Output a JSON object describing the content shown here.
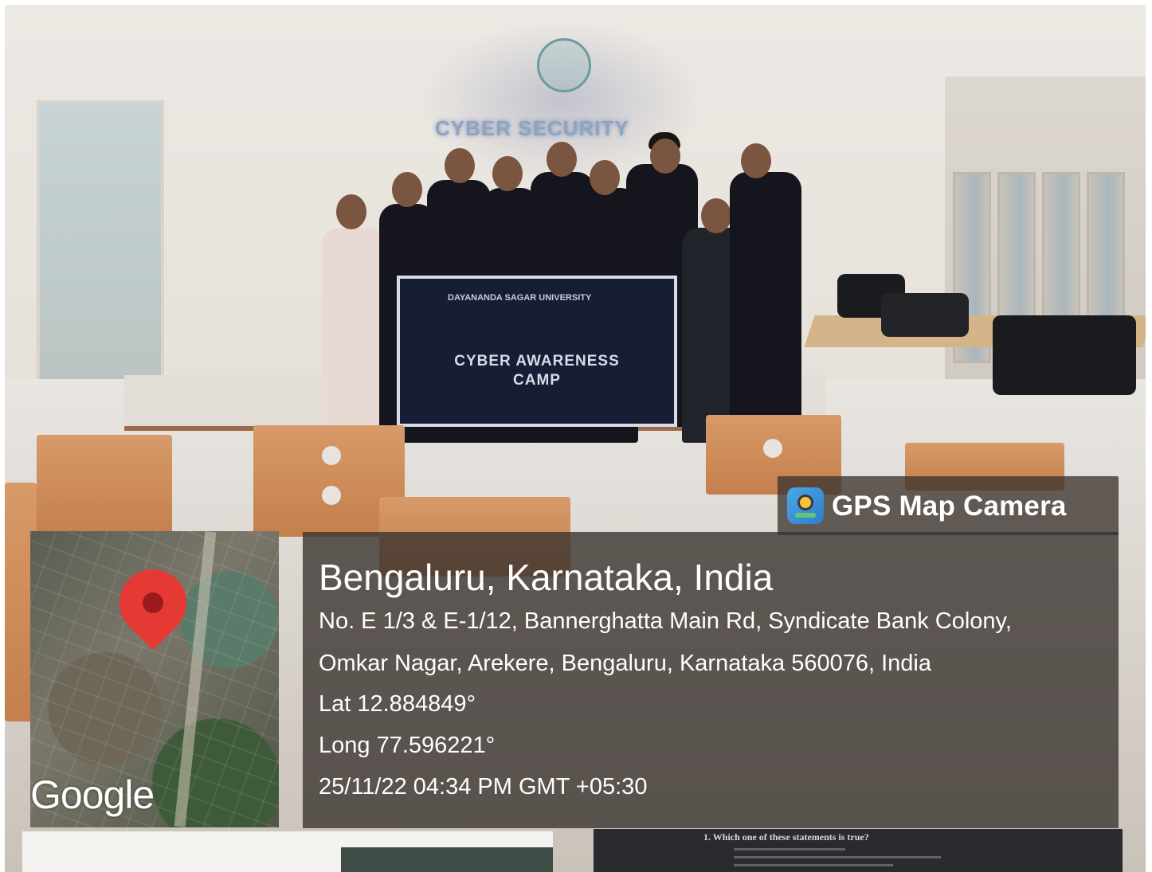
{
  "gps_app": {
    "icon": "map-camera-icon",
    "label": "GPS Map Camera"
  },
  "location": {
    "title": "Bengaluru, Karnataka, India",
    "address_line1": "No. E 1/3 & E-1/12, Bannerghatta Main Rd, Syndicate Bank Colony,",
    "address_line2": "Omkar Nagar, Arekere, Bengaluru, Karnataka 560076, India",
    "latitude": "Lat 12.884849°",
    "longitude": "Long 77.596221°",
    "timestamp": "25/11/22 04:34 PM GMT +05:30"
  },
  "map": {
    "attribution": "Google",
    "pin_color": "#e53935"
  },
  "scene": {
    "projection_title": "CYBER SECURITY",
    "banner_heading": "DAYANANDA SAGAR UNIVERSITY",
    "banner_title_line1": "CYBER AWARENESS",
    "banner_title_line2": "CAMP"
  },
  "lower_slide": {
    "question": "1. Which one of these statements is true?"
  }
}
